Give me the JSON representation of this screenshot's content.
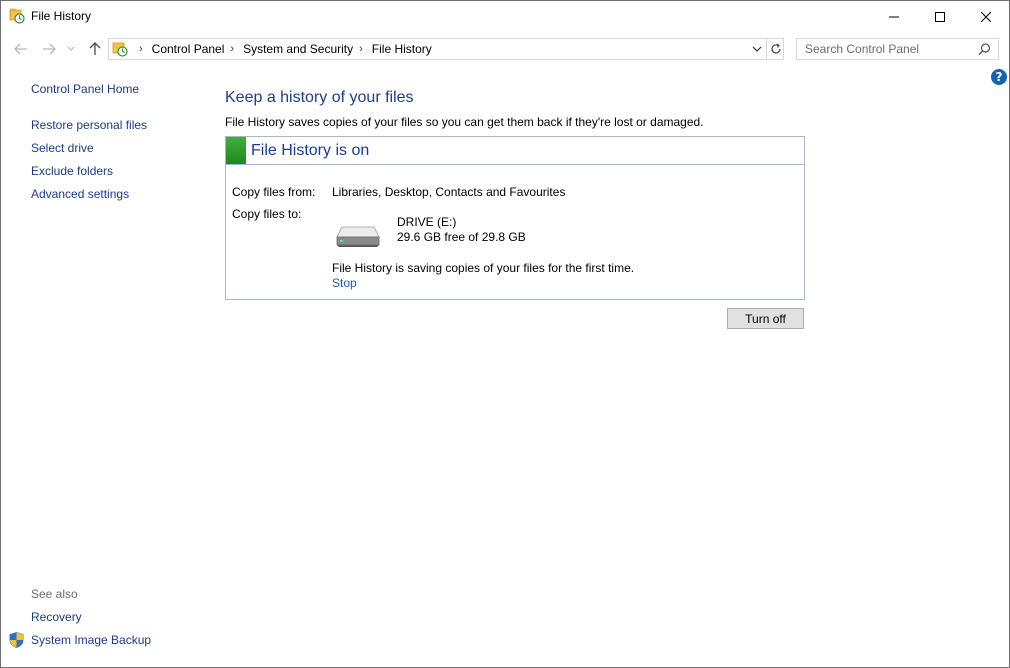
{
  "window": {
    "title": "File History"
  },
  "address": {
    "crumbs": [
      "Control Panel",
      "System and Security",
      "File History"
    ]
  },
  "search": {
    "placeholder": "Search Control Panel"
  },
  "sidebar": {
    "home": "Control Panel Home",
    "links": [
      "Restore personal files",
      "Select drive",
      "Exclude folders",
      "Advanced settings"
    ],
    "see_also_label": "See also",
    "see_also_links": [
      "Recovery",
      "System Image Backup"
    ]
  },
  "main": {
    "title": "Keep a history of your files",
    "description": "File History saves copies of your files so you can get them back if they're lost or damaged.",
    "status": {
      "title": "File History is on",
      "color": "#2a9d2a"
    },
    "copy_from_label": "Copy files from:",
    "copy_from_value": "Libraries, Desktop, Contacts and Favourites",
    "copy_to_label": "Copy files to:",
    "drive_name": "DRIVE (E:)",
    "drive_free": "29.6 GB free of 29.8 GB",
    "saving_message": "File History is saving copies of your files for the first time.",
    "stop_link": "Stop",
    "turn_off_button": "Turn off"
  },
  "icons": {
    "title": "file-history-icon",
    "help": "help-icon",
    "shield": "uac-shield-icon",
    "drive": "hard-drive-icon"
  },
  "help_glyph": "?"
}
